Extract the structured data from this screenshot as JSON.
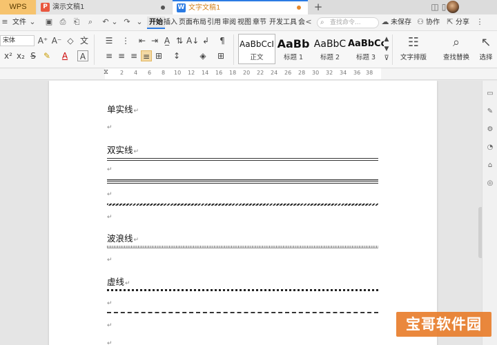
{
  "tabbar": {
    "logo": "WPS",
    "tabs": [
      {
        "icon": "P",
        "label": "演示文稿1"
      },
      {
        "icon": "W",
        "label": "文字文稿1"
      }
    ],
    "new_tab": "+"
  },
  "menubar": {
    "file_label": "文件",
    "tabs": [
      "开始",
      "插入",
      "页面布局",
      "引用",
      "审阅",
      "视图",
      "章节",
      "开发工具",
      "会"
    ],
    "more": "<",
    "search_placeholder": "查找命令...",
    "unsaved": "未保存",
    "collab": "协作",
    "share": "分享"
  },
  "ribbon": {
    "font_name": "宋体",
    "styles": [
      {
        "sample": "AaBbCcI",
        "name": "正文"
      },
      {
        "sample": "AaBb",
        "name": "标题 1"
      },
      {
        "sample": "AaBbC",
        "name": "标题 2"
      },
      {
        "sample": "AaBbCc",
        "name": "标题 3"
      }
    ],
    "text_layout": "文字排版",
    "find_replace": "查找替换",
    "select": "选择"
  },
  "ruler": {
    "numbers": [
      "2",
      "4",
      "6",
      "8",
      "10",
      "12",
      "14",
      "16",
      "18",
      "20",
      "22",
      "24",
      "26",
      "28",
      "30",
      "32",
      "34",
      "36",
      "38"
    ]
  },
  "document": {
    "para_mark": "↵",
    "single_label": "单实线",
    "double_label": "双实线",
    "wave_label": "波浪线",
    "dotted_label": "虚线"
  },
  "watermark": "宝哥软件园",
  "colors": {
    "accent_blue": "#2b7be3",
    "wps_orange": "#f6c36e",
    "doc_tab_text": "#d4821c",
    "ppt_red": "#e9573f"
  }
}
